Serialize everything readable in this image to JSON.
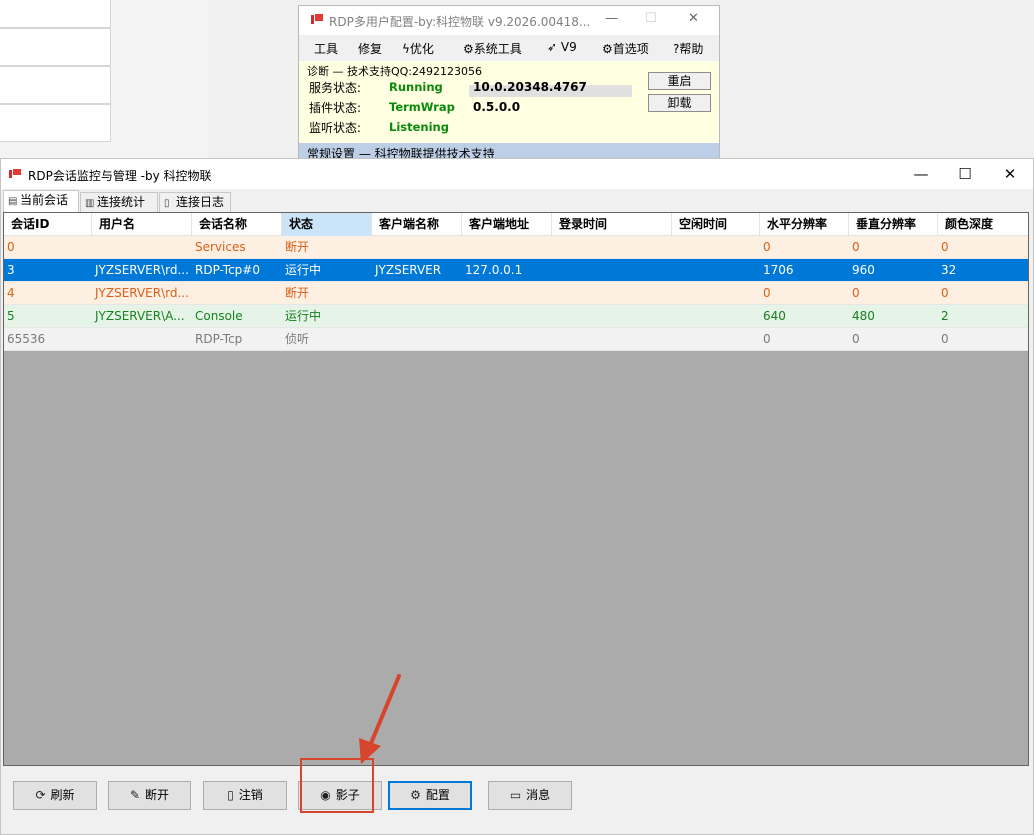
{
  "back_window": {
    "title": "RDP多用户配置-by:科控物联 v9.2026.00418...",
    "menu": [
      {
        "label": "工具",
        "icon": ""
      },
      {
        "label": "修复",
        "icon": ""
      },
      {
        "label": "优化",
        "icon": "lightning-icon"
      },
      {
        "label": "系统工具",
        "icon": "gear-icon"
      },
      {
        "label": "V9",
        "icon": "rocket-icon"
      },
      {
        "label": "首选项",
        "icon": "gear-icon"
      },
      {
        "label": "帮助",
        "icon": "help-icon"
      }
    ],
    "diag_header": "诊断 — 技术支持QQ:2492123056",
    "service_label": "服务状态:",
    "service_value": "Running",
    "service_version": "10.0.20348.4767",
    "plugin_label": "插件状态:",
    "plugin_value": "TermWrap",
    "plugin_version": "0.5.0.0",
    "listen_label": "监听状态:",
    "listen_value": "Listening",
    "restart_label": "重启",
    "uninstall_label": "卸载",
    "footer": "常规设置 — 科控物联提供技术支持"
  },
  "main_window": {
    "title": "RDP会话监控与管理 -by 科控物联",
    "controls": {
      "minimize": "—",
      "maximize": "☐",
      "close": "✕"
    }
  },
  "tabs": [
    {
      "label": "当前会话",
      "icon": "table-icon",
      "active": true
    },
    {
      "label": "连接统计",
      "icon": "chart-icon",
      "active": false
    },
    {
      "label": "连接日志",
      "icon": "log-icon",
      "active": false
    }
  ],
  "table": {
    "columns": [
      "会话ID",
      "用户名",
      "会话名称",
      "状态",
      "客户端名称",
      "客户端地址",
      "登录时间",
      "空闲时间",
      "水平分辨率",
      "垂直分辨率",
      "颜色深度"
    ],
    "selected_column": 3,
    "rows": [
      {
        "style": "disconnected",
        "cells": [
          "0",
          "",
          "Services",
          "断开",
          "",
          "",
          "",
          "",
          "0",
          "0",
          "0"
        ]
      },
      {
        "style": "selected",
        "cells": [
          "3",
          "JYZSERVER\\rd...",
          "RDP-Tcp#0",
          "运行中",
          "JYZSERVER",
          "127.0.0.1",
          "",
          "",
          "1706",
          "960",
          "32"
        ]
      },
      {
        "style": "disconnected",
        "cells": [
          "4",
          "JYZSERVER\\rd...",
          "",
          "断开",
          "",
          "",
          "",
          "",
          "0",
          "0",
          "0"
        ]
      },
      {
        "style": "active",
        "cells": [
          "5",
          "JYZSERVER\\A...",
          "Console",
          "运行中",
          "",
          "",
          "",
          "",
          "640",
          "480",
          "2"
        ]
      },
      {
        "style": "listening",
        "cells": [
          "65536",
          "",
          "RDP-Tcp",
          "侦听",
          "",
          "",
          "",
          "",
          "0",
          "0",
          "0"
        ]
      }
    ]
  },
  "buttons": [
    {
      "label": "刷新",
      "icon": "refresh-icon"
    },
    {
      "label": "断开",
      "icon": "disconnect-icon"
    },
    {
      "label": "注销",
      "icon": "logoff-icon"
    },
    {
      "label": "影子",
      "icon": "eye-icon"
    },
    {
      "label": "配置",
      "icon": "gear-icon"
    },
    {
      "label": "消息",
      "icon": "message-icon"
    }
  ],
  "colors": {
    "disconnected_bg": "#fdf0e2",
    "disconnected_text": "#d9601a",
    "selected_bg": "#0078d7",
    "active_bg": "#e6f4e8",
    "active_text": "#17801f",
    "listening_bg": "#f2f2f2",
    "listening_text": "#7a7a7a",
    "annotation": "#d6452d"
  }
}
